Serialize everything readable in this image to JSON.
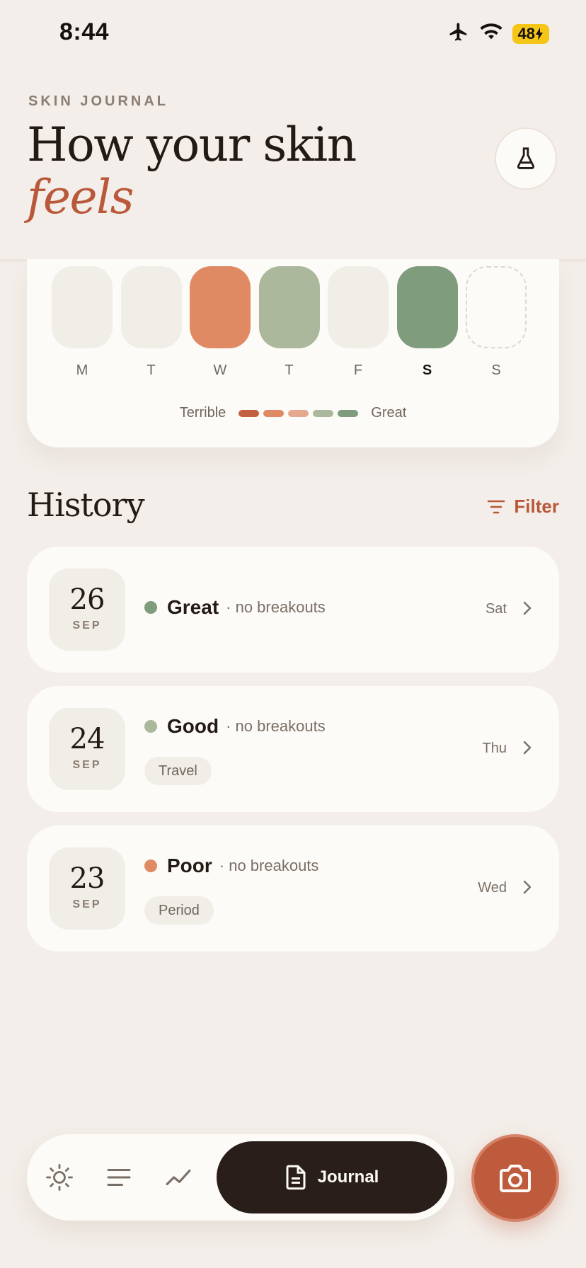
{
  "status": {
    "time": "8:44",
    "battery": "48"
  },
  "header": {
    "eyebrow": "SKIN JOURNAL",
    "title_line1": "How your skin",
    "title_line2": "feels"
  },
  "week": {
    "days": [
      {
        "label": "M",
        "color": "#f1ede7",
        "today": false,
        "empty": false
      },
      {
        "label": "T",
        "color": "#f1ede7",
        "today": false,
        "empty": false
      },
      {
        "label": "W",
        "color": "#e08a64",
        "today": false,
        "empty": false
      },
      {
        "label": "T",
        "color": "#abb89c",
        "today": false,
        "empty": false
      },
      {
        "label": "F",
        "color": "#f1ede7",
        "today": false,
        "empty": false
      },
      {
        "label": "S",
        "color": "#7f9c7d",
        "today": true,
        "empty": false
      },
      {
        "label": "S",
        "color": "transparent",
        "today": false,
        "empty": true
      }
    ],
    "legend_low": "Terrible",
    "legend_high": "Great",
    "scale_colors": [
      "#c2603f",
      "#e08a64",
      "#e4a98f",
      "#abb89c",
      "#7f9c7d"
    ]
  },
  "history": {
    "title": "History",
    "filter_label": "Filter",
    "entries": [
      {
        "day": "26",
        "month": "SEP",
        "rating": "Great",
        "note": "· no breakouts",
        "tag": "",
        "weekday": "Sat",
        "color": "#7f9c7d"
      },
      {
        "day": "24",
        "month": "SEP",
        "rating": "Good",
        "note": "· no breakouts",
        "tag": "Travel",
        "weekday": "Thu",
        "color": "#abb89c"
      },
      {
        "day": "23",
        "month": "SEP",
        "rating": "Poor",
        "note": "· no breakouts",
        "tag": "Period",
        "weekday": "Wed",
        "color": "#e08a64"
      }
    ]
  },
  "tabbar": {
    "active_label": "Journal",
    "accent": "#bd5b3c"
  }
}
